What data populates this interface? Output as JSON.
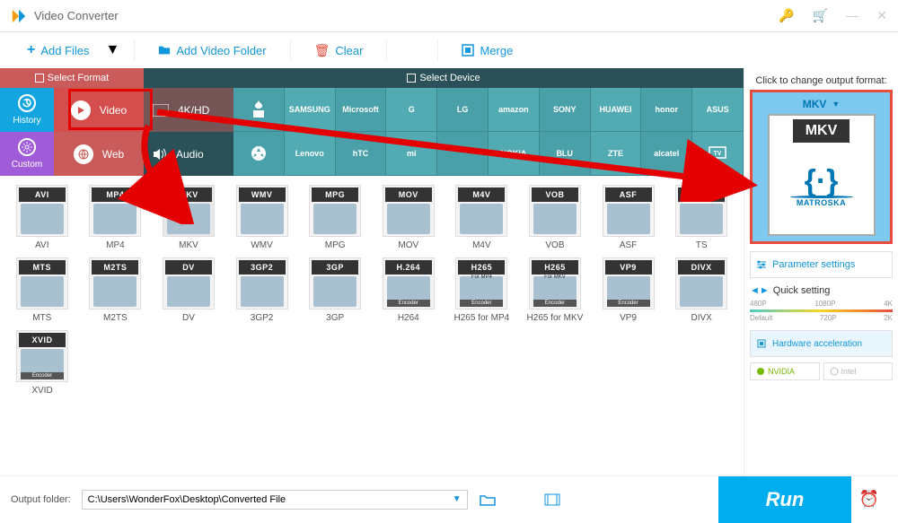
{
  "app": {
    "title": "Video Converter"
  },
  "toolbar": {
    "add_files": "Add Files",
    "add_folder": "Add Video Folder",
    "clear": "Clear",
    "merge": "Merge"
  },
  "strip": {
    "select_format": "Select Format",
    "select_device": "Select Device"
  },
  "sidebar": {
    "history": "History",
    "custom": "Custom"
  },
  "cats": {
    "video": "Video",
    "web": "Web",
    "hd": "4K/HD",
    "audio": "Audio"
  },
  "brands": [
    "",
    "SAMSUNG",
    "Microsoft",
    "G",
    "LG",
    "amazon",
    "SONY",
    "HUAWEI",
    "honor",
    "ASUS",
    "",
    "Lenovo",
    "hTC",
    "mi",
    "",
    "NOKIA",
    "BLU",
    "ZTE",
    "alcatel",
    "TV"
  ],
  "formats_row1": [
    {
      "badge": "AVI",
      "label": "AVI"
    },
    {
      "badge": "MP4",
      "label": "MP4"
    },
    {
      "badge": "MKV",
      "label": "MKV",
      "sub": "MATROSKA"
    },
    {
      "badge": "WMV",
      "label": "WMV"
    },
    {
      "badge": "MPG",
      "label": "MPG"
    },
    {
      "badge": "MOV",
      "label": "MOV"
    },
    {
      "badge": "M4V",
      "label": "M4V"
    },
    {
      "badge": "VOB",
      "label": "VOB"
    },
    {
      "badge": "ASF",
      "label": "ASF"
    },
    {
      "badge": "TS",
      "label": "TS"
    }
  ],
  "formats_row2": [
    {
      "badge": "MTS",
      "label": "MTS"
    },
    {
      "badge": "M2TS",
      "label": "M2TS"
    },
    {
      "badge": "DV",
      "label": "DV"
    },
    {
      "badge": "3GP2",
      "label": "3GP2"
    },
    {
      "badge": "3GP",
      "label": "3GP"
    },
    {
      "badge": "H.264",
      "label": "H264",
      "enc": true
    },
    {
      "badge": "H265",
      "label": "H265 for MP4",
      "enc": true,
      "note": "For MP4"
    },
    {
      "badge": "H265",
      "label": "H265 for MKV",
      "enc": true,
      "note": "For MKV"
    },
    {
      "badge": "VP9",
      "label": "VP9",
      "enc": true
    },
    {
      "badge": "DIVX",
      "label": "DIVX"
    }
  ],
  "formats_row3": [
    {
      "badge": "XVID",
      "label": "XVID",
      "enc": true
    }
  ],
  "right": {
    "title": "Click to change output format:",
    "selected": "MKV",
    "selected_sub": "MATROSKA",
    "param": "Parameter settings",
    "quick": "Quick setting",
    "scale_top": [
      "480P",
      "1080P",
      "4K"
    ],
    "scale_bot": [
      "Default",
      "720P",
      "2K"
    ],
    "hw": "Hardware acceleration",
    "nvidia": "NVIDIA",
    "intel": "Intel"
  },
  "bottom": {
    "label": "Output folder:",
    "path": "C:\\Users\\WonderFox\\Desktop\\Converted File",
    "run": "Run"
  }
}
